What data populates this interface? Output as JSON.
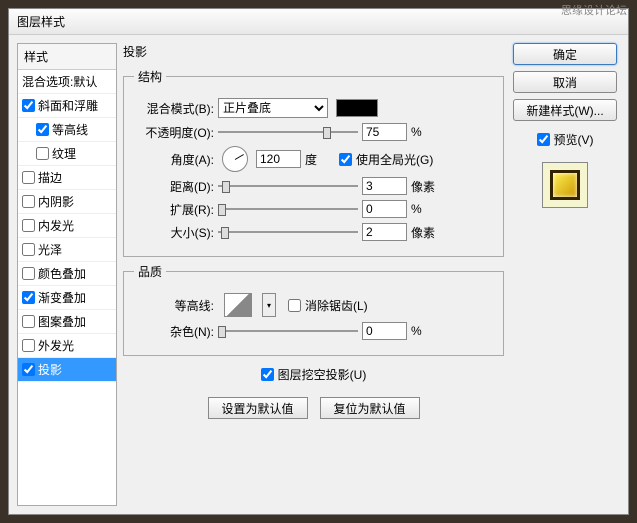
{
  "watermark": "思缘设计论坛",
  "title": "图层样式",
  "sidebar": {
    "header": "样式",
    "items": [
      {
        "label": "混合选项:默认",
        "checked": null
      },
      {
        "label": "斜面和浮雕",
        "checked": true
      },
      {
        "label": "等高线",
        "checked": true,
        "indent": true
      },
      {
        "label": "纹理",
        "checked": false,
        "indent": true
      },
      {
        "label": "描边",
        "checked": false
      },
      {
        "label": "内阴影",
        "checked": false
      },
      {
        "label": "内发光",
        "checked": false
      },
      {
        "label": "光泽",
        "checked": false
      },
      {
        "label": "颜色叠加",
        "checked": false
      },
      {
        "label": "渐变叠加",
        "checked": true
      },
      {
        "label": "图案叠加",
        "checked": false
      },
      {
        "label": "外发光",
        "checked": false
      },
      {
        "label": "投影",
        "checked": true,
        "selected": true
      }
    ]
  },
  "panel": {
    "title": "投影",
    "structure": {
      "legend": "结构",
      "blendMode": {
        "label": "混合模式(B):",
        "value": "正片叠底"
      },
      "opacity": {
        "label": "不透明度(O):",
        "value": "75",
        "unit": "%"
      },
      "angle": {
        "label": "角度(A):",
        "value": "120",
        "unit": "度",
        "globalLight": "使用全局光(G)",
        "globalChecked": true
      },
      "distance": {
        "label": "距离(D):",
        "value": "3",
        "unit": "像素"
      },
      "spread": {
        "label": "扩展(R):",
        "value": "0",
        "unit": "%"
      },
      "size": {
        "label": "大小(S):",
        "value": "2",
        "unit": "像素"
      }
    },
    "quality": {
      "legend": "品质",
      "contour": {
        "label": "等高线:",
        "antialias": "消除锯齿(L)",
        "antialiasChecked": false
      },
      "noise": {
        "label": "杂色(N):",
        "value": "0",
        "unit": "%"
      }
    },
    "knockout": {
      "label": "图层挖空投影(U)",
      "checked": true
    },
    "buttons": {
      "setDefault": "设置为默认值",
      "resetDefault": "复位为默认值"
    }
  },
  "actions": {
    "ok": "确定",
    "cancel": "取消",
    "newStyle": "新建样式(W)...",
    "preview": "预览(V)",
    "previewChecked": true
  }
}
